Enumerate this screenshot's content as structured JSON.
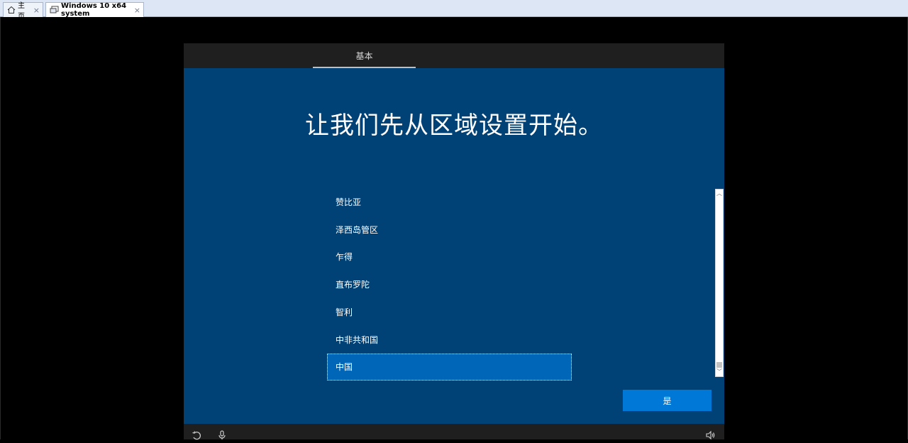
{
  "host": {
    "tabs": [
      {
        "label": "主页",
        "icon": "home-icon",
        "close": "×"
      },
      {
        "label": "Windows 10 x64 system",
        "icon": "vm-icon",
        "close": "×"
      }
    ]
  },
  "oobe": {
    "section_tab": "基本",
    "heading": "让我们先从区域设置开始。",
    "regions": [
      "赞比亚",
      "泽西岛管区",
      "乍得",
      "直布罗陀",
      "智利",
      "中非共和国",
      "中国"
    ],
    "selected_region": "中国",
    "yes_label": "是",
    "bottom_icons": [
      "ease-of-access-icon",
      "microphone-icon",
      "volume-icon"
    ],
    "colors": {
      "background": "#004275",
      "selected": "#0067b8",
      "button": "#0078d7",
      "bar": "#1f1f1f"
    }
  }
}
